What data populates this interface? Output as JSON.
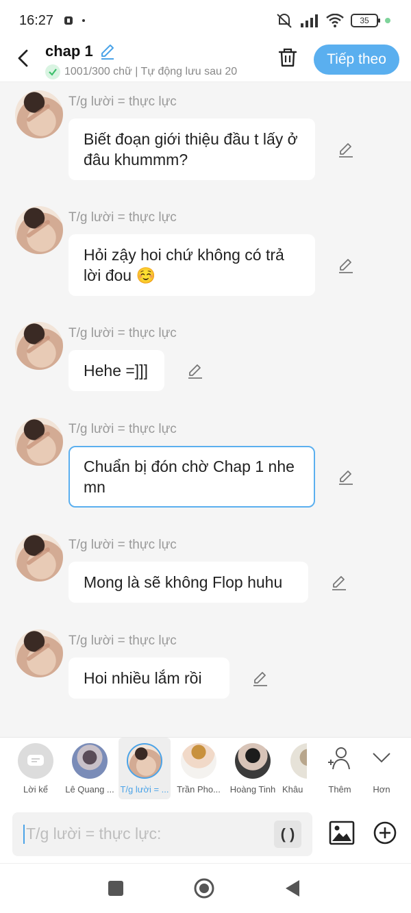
{
  "status_bar": {
    "time": "16:27",
    "battery": "35"
  },
  "header": {
    "title": "chap 1",
    "subtitle": "1001/300 chữ | Tự động lưu sau 20",
    "next_label": "Tiếp theo"
  },
  "messages": [
    {
      "author": "T/g lười = thực lực",
      "text": "Biết đoạn giới thiệu đầu t lấy ở đâu khummm?"
    },
    {
      "author": "T/g lười = thực lực",
      "text": "Hỏi zậy hoi chứ không có trả lời đou ☺️"
    },
    {
      "author": "T/g lười = thực lực",
      "text": "Hehe =]]]"
    },
    {
      "author": "T/g lười = thực lực",
      "text": "Chuẩn bị đón chờ Chap 1 nhe mn"
    },
    {
      "author": "T/g lười = thực lực",
      "text": "Mong là sẽ không Flop huhu"
    },
    {
      "author": "T/g lười = thực lực",
      "text": "Hoi nhiều lắm rồi"
    }
  ],
  "characters": [
    {
      "label": "Lời kể"
    },
    {
      "label": "Lê Quang ..."
    },
    {
      "label": "T/g lười = ..."
    },
    {
      "label": "Trần Pho..."
    },
    {
      "label": "Hoàng Tinh"
    },
    {
      "label": "Khâu"
    },
    {
      "label": "Thêm"
    },
    {
      "label": "Hơn"
    }
  ],
  "input": {
    "placeholder": "T/g lười = thực lực:",
    "paren_label": "( )"
  },
  "colors": {
    "accent": "#5aafef",
    "background": "#f5f5f5",
    "bubble": "#ffffff"
  }
}
